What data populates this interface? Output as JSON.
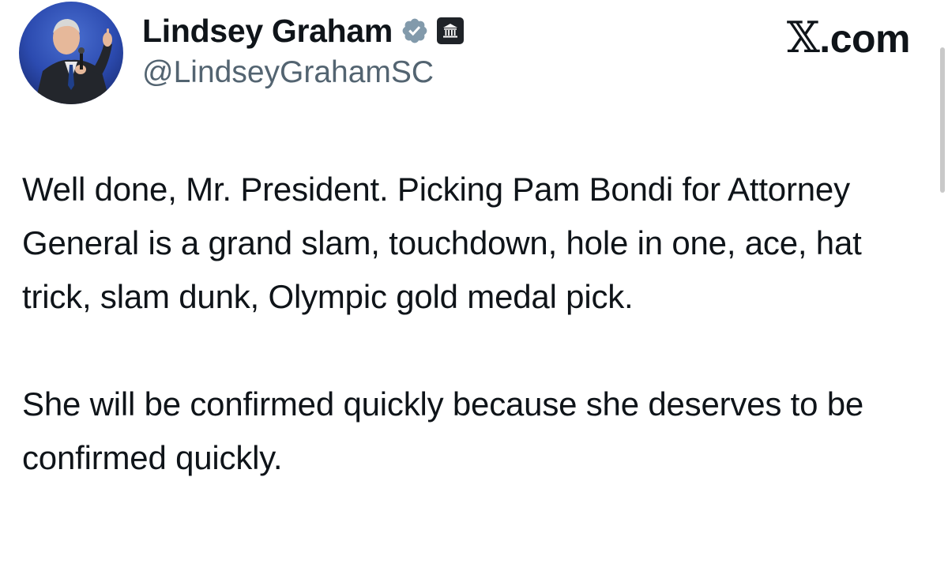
{
  "author": {
    "display_name": "Lindsey Graham",
    "handle": "@LindseyGrahamSC",
    "avatar_icon": "avatar-photo",
    "verified_icon": "verified-badge-icon",
    "affiliation_icon": "government-building-icon"
  },
  "site": {
    "label": ".com",
    "logo_glyph": "𝕏"
  },
  "tweet": {
    "paragraph_1": "Well done, Mr. President. Picking Pam Bondi for Attorney General is a grand slam, touchdown, hole in one, ace, hat trick, slam dunk, Olympic gold medal pick.",
    "paragraph_2": "She will be confirmed quickly because she deserves to be confirmed quickly."
  },
  "colors": {
    "text": "#0f1419",
    "secondary": "#536471",
    "badge_gray": "#829aab",
    "background": "#ffffff"
  }
}
